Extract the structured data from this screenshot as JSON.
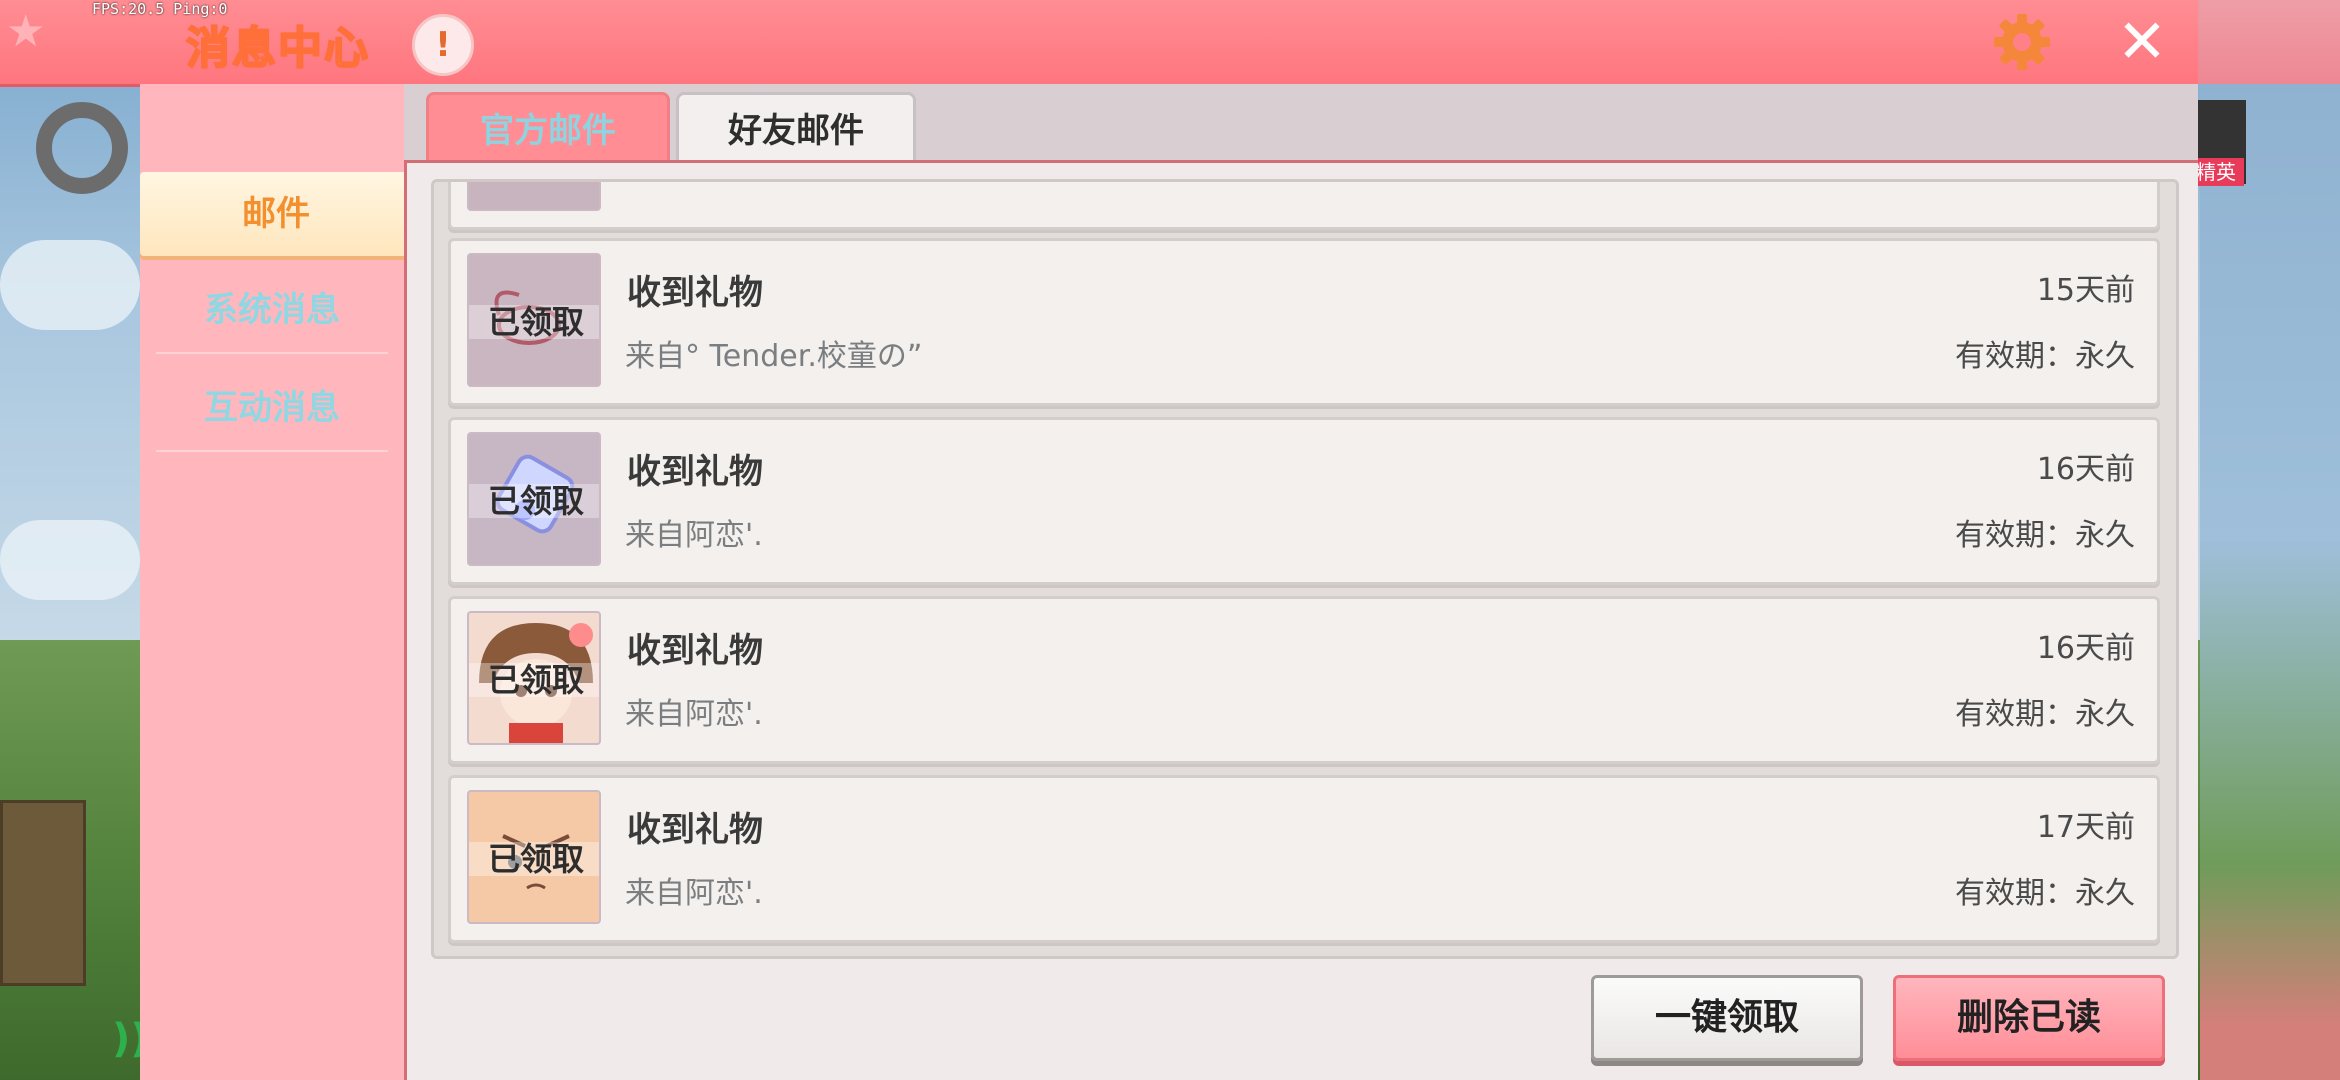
{
  "debug": {
    "fps_text": "FPS:20.5  Ping:0"
  },
  "header": {
    "title": "消息中心",
    "alert_icon": "!",
    "settings_icon": "gear-icon",
    "close_icon": "close-icon"
  },
  "overlay": {
    "side_badge_label": "精英"
  },
  "sidebar": {
    "items": [
      {
        "label": "邮件",
        "active": true
      },
      {
        "label": "系统消息",
        "active": false
      },
      {
        "label": "互动消息",
        "active": false
      }
    ]
  },
  "tabs": [
    {
      "label": "官方邮件",
      "active": false
    },
    {
      "label": "好友邮件",
      "active": true
    }
  ],
  "mails": [
    {
      "title": "收到礼物",
      "from": "来自° Tender.校童の”",
      "time": "15天前",
      "expire": "有效期：永久",
      "status": "已领取",
      "thumb": "gift-ribbon-icon"
    },
    {
      "title": "收到礼物",
      "from": "来自阿恋'.",
      "time": "16天前",
      "expire": "有效期：永久",
      "status": "已领取",
      "thumb": "crystal-tile-icon"
    },
    {
      "title": "收到礼物",
      "from": "来自阿恋'.",
      "time": "16天前",
      "expire": "有效期：永久",
      "status": "已领取",
      "thumb": "anime-girl-avatar"
    },
    {
      "title": "收到礼物",
      "from": "来自阿恋'.",
      "time": "17天前",
      "expire": "有效期：永久",
      "status": "已领取",
      "thumb": "face-emote-icon"
    }
  ],
  "actions": {
    "claim_all": "一键领取",
    "delete_read": "删除已读"
  },
  "colors": {
    "header": "#ff767f",
    "sidebar": "#ffb7bd",
    "active_tab_text": "#2e2e2e",
    "accent_orange": "#f48f2e",
    "delete_button": "#ff8e98"
  }
}
